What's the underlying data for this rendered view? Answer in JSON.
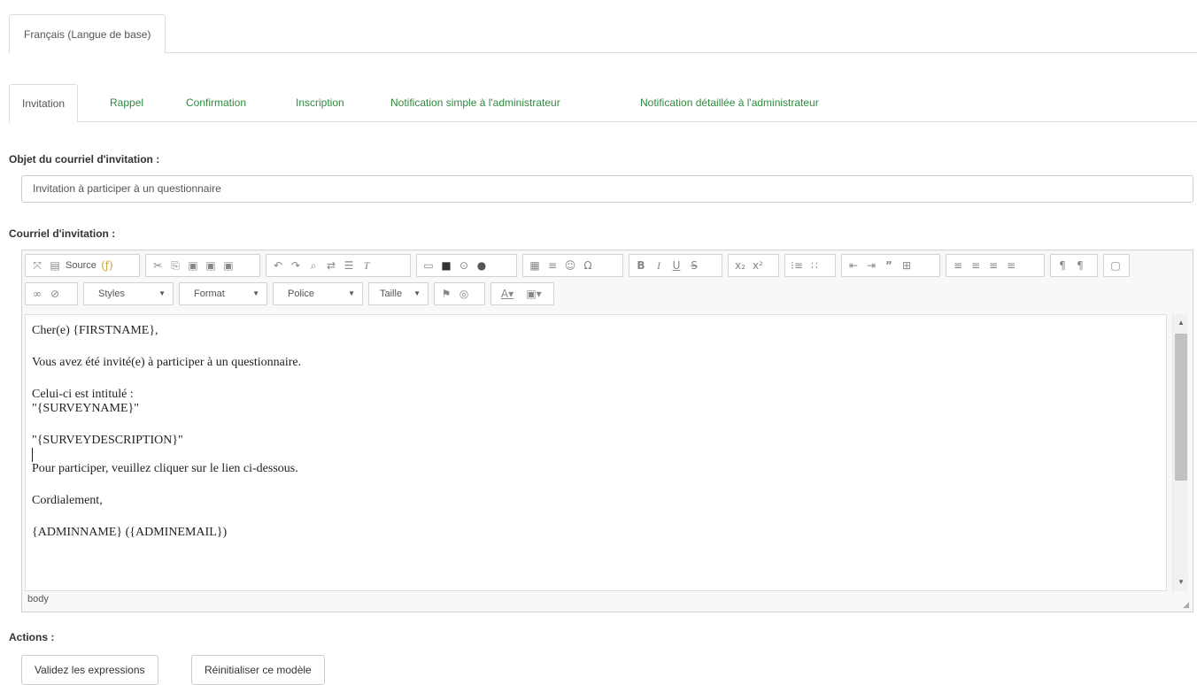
{
  "language_tab": {
    "label": "Français (Langue de base)"
  },
  "template_tabs": [
    {
      "label": "Invitation",
      "active": true
    },
    {
      "label": "Rappel",
      "active": false
    },
    {
      "label": "Confirmation",
      "active": false
    },
    {
      "label": "Inscription",
      "active": false
    },
    {
      "label": "Notification simple à l'administrateur",
      "active": false
    },
    {
      "label": "Notification détaillée à l'administrateur",
      "active": false
    }
  ],
  "subject": {
    "label": "Objet du courriel d'invitation :",
    "value": "Invitation à participer à un questionnaire"
  },
  "body": {
    "label": "Courriel d'invitation :",
    "toolbar": {
      "source_label": "Source",
      "styles_label": "Styles",
      "format_label": "Format",
      "font_label": "Police",
      "size_label": "Taille"
    },
    "lines": [
      "Cher(e) {FIRSTNAME},",
      "Vous avez été invité(e) à participer à un questionnaire.",
      "Celui-ci est intitulé :",
      "\"{SURVEYNAME}\"",
      "\"{SURVEYDESCRIPTION}\"",
      "Pour participer, veuillez cliquer sur le lien ci-dessous.",
      "Cordialement,",
      "{ADMINNAME} ({ADMINEMAIL})"
    ],
    "status_path": "body"
  },
  "actions": {
    "label": "Actions :",
    "validate_label": "Validez les expressions",
    "reset_label": "Réinitialiser ce modèle"
  },
  "colors": {
    "tab_link": "#2e8b3e",
    "border": "#dddddd"
  }
}
